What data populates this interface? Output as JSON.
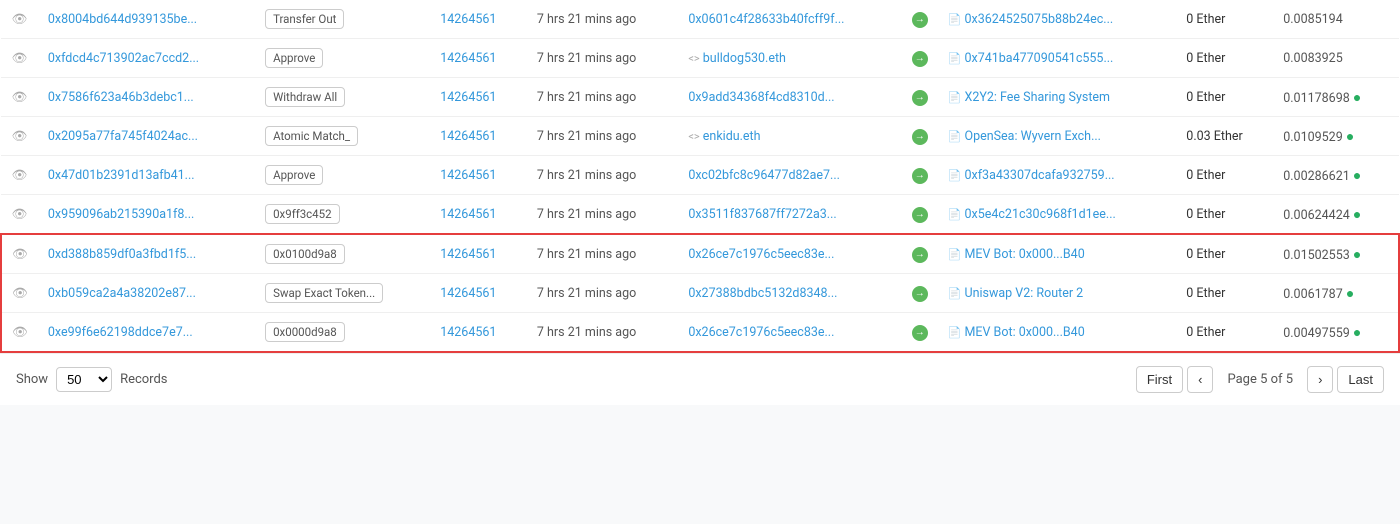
{
  "table": {
    "rows": [
      {
        "id": "row-1",
        "txHash": "0x8004bd644d939135be...",
        "method": "Transfer Out",
        "block": "14264561",
        "age": "7 hrs 21 mins ago",
        "from": "0x0601c4f28633b40fcff9f...",
        "to": "0x3624525075b88b24ec...",
        "value": "0 Ether",
        "fee": "0.0085194",
        "hasArrow": true,
        "toIsContract": true,
        "fromIsENS": false,
        "highlighted": false
      },
      {
        "id": "row-2",
        "txHash": "0xfdcd4c713902ac7ccd2...",
        "method": "Approve",
        "block": "14264561",
        "age": "7 hrs 21 mins ago",
        "from": "<> bulldog530.eth",
        "to": "0x741ba477090541c555...",
        "value": "0 Ether",
        "fee": "0.0083925",
        "hasArrow": true,
        "toIsContract": true,
        "fromIsENS": true,
        "fromENS": "bulldog530.eth",
        "highlighted": false
      },
      {
        "id": "row-3",
        "txHash": "0x7586f623a46b3debc1...",
        "method": "Withdraw All",
        "block": "14264561",
        "age": "7 hrs 21 mins ago",
        "from": "0x9add34368f4cd8310d...",
        "to": "X2Y2: Fee Sharing System",
        "value": "0 Ether",
        "fee": "0.01178698",
        "hasArrow": true,
        "toIsContract": true,
        "fromIsENS": false,
        "highlighted": false,
        "hasGreenDot": true
      },
      {
        "id": "row-4",
        "txHash": "0x2095a77fa745f4024ac...",
        "method": "Atomic Match_",
        "block": "14264561",
        "age": "7 hrs 21 mins ago",
        "from": "<> enkidu.eth",
        "fromENS": "enkidu.eth",
        "to": "OpenSea: Wyvern Exch...",
        "value": "0.03 Ether",
        "fee": "0.0109529",
        "hasArrow": true,
        "toIsContract": true,
        "fromIsENS": true,
        "highlighted": false,
        "hasGreenDot": true
      },
      {
        "id": "row-5",
        "txHash": "0x47d01b2391d13afb41...",
        "method": "Approve",
        "block": "14264561",
        "age": "7 hrs 21 mins ago",
        "from": "0xc02bfc8c96477d82ae7...",
        "to": "0xf3a43307dcafa932759...",
        "value": "0 Ether",
        "fee": "0.00286621",
        "hasArrow": true,
        "toIsContract": true,
        "fromIsENS": false,
        "highlighted": false,
        "hasGreenDot": true
      },
      {
        "id": "row-6",
        "txHash": "0x959096ab215390a1f8...",
        "method": "0x9ff3c452",
        "block": "14264561",
        "age": "7 hrs 21 mins ago",
        "from": "0x3511f837687ff7272a3...",
        "to": "0x5e4c21c30c968f1d1ee...",
        "value": "0 Ether",
        "fee": "0.00624424",
        "hasArrow": true,
        "toIsContract": true,
        "fromIsENS": false,
        "highlighted": false,
        "hasGreenDot": true
      },
      {
        "id": "row-7",
        "txHash": "0xd388b859df0a3fbd1f5...",
        "method": "0x0100d9a8",
        "block": "14264561",
        "age": "7 hrs 21 mins ago",
        "from": "0x26ce7c1976c5eec83e...",
        "to": "MEV Bot: 0x000...B40",
        "value": "0 Ether",
        "fee": "0.01502553",
        "hasArrow": true,
        "toIsContract": true,
        "fromIsENS": false,
        "highlighted": true,
        "hasGreenDot": true
      },
      {
        "id": "row-8",
        "txHash": "0xb059ca2a4a38202e87...",
        "method": "Swap Exact Token...",
        "block": "14264561",
        "age": "7 hrs 21 mins ago",
        "from": "0x27388bdbc5132d8348...",
        "to": "Uniswap V2: Router 2",
        "value": "0 Ether",
        "fee": "0.0061787",
        "hasArrow": true,
        "toIsContract": true,
        "fromIsENS": false,
        "highlighted": true,
        "hasGreenDot": true
      },
      {
        "id": "row-9",
        "txHash": "0xe99f6e62198ddce7e7...",
        "method": "0x0000d9a8",
        "block": "14264561",
        "age": "7 hrs 21 mins ago",
        "from": "0x26ce7c1976c5eec83e...",
        "to": "MEV Bot: 0x000...B40",
        "value": "0 Ether",
        "fee": "0.00497559",
        "hasArrow": true,
        "toIsContract": true,
        "fromIsENS": false,
        "highlighted": true,
        "hasGreenDot": true
      }
    ]
  },
  "pagination": {
    "show_label": "Show",
    "records_label": "Records",
    "records_value": "50",
    "page_info": "Page 5 of 5",
    "first_label": "First",
    "last_label": "Last",
    "prev_icon": "‹",
    "next_icon": "›"
  },
  "colors": {
    "highlight_border": "#e53e3e",
    "link_color": "#3498db",
    "green": "#27ae60"
  }
}
